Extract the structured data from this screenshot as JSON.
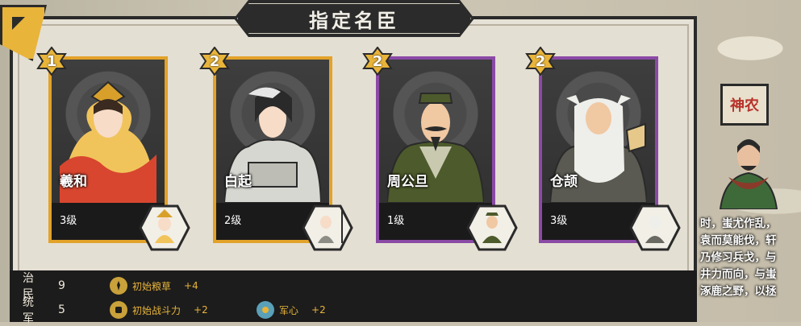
{
  "title": "指定名臣",
  "cards": [
    {
      "rank": "1",
      "name": "羲和",
      "level": "3级",
      "border": "#e2a229"
    },
    {
      "rank": "2",
      "name": "白起",
      "level": "2级",
      "border": "#e2a229"
    },
    {
      "rank": "2",
      "name": "周公旦",
      "level": "1级",
      "border": "#8b4aa5"
    },
    {
      "rank": "2",
      "name": "仓颉",
      "level": "3级",
      "border": "#8b4aa5"
    }
  ],
  "stats": [
    {
      "label": "治民",
      "value": "9",
      "effects": [
        {
          "icon": "grain-icon",
          "text": "初始粮草",
          "bonus": "+4"
        }
      ]
    },
    {
      "label": "统军",
      "value": "5",
      "effects": [
        {
          "icon": "fist-icon",
          "text": "初始战斗力",
          "bonus": "+2"
        },
        {
          "icon": "morale-icon",
          "text": "军心",
          "bonus": "+2"
        }
      ]
    }
  ],
  "side": {
    "sign": "神农",
    "lines": [
      "时，蚩尤作乱，",
      "袁而莫能伐，轩",
      "乃修习兵戈，与",
      "井力而向，与蚩",
      "涿鹿之野，以拯"
    ]
  },
  "colors": {
    "gold": "#e2a229",
    "purple": "#8b4aa5",
    "panel": "#e6e1d6",
    "dark": "#1c1c1c"
  }
}
